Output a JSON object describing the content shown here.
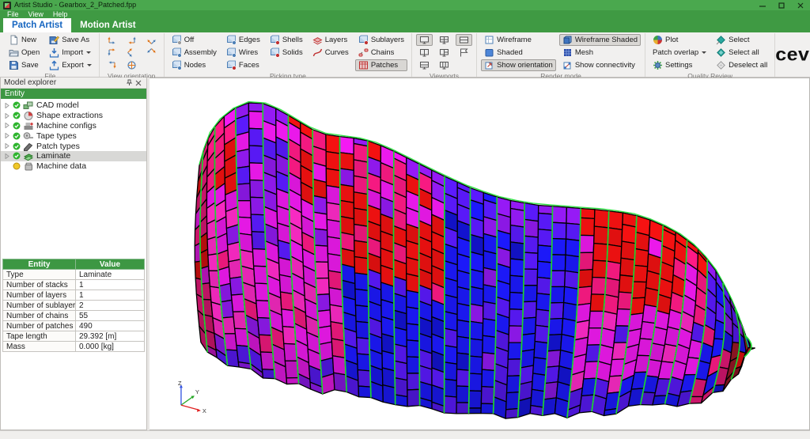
{
  "window": {
    "title": "Artist Studio - Gearbox_2_Patched.fpp"
  },
  "menu": {
    "items": [
      "File",
      "View",
      "Help"
    ]
  },
  "tabs": [
    {
      "label": "Patch Artist",
      "active": true
    },
    {
      "label": "Motion Artist",
      "active": false
    }
  ],
  "logo": "cevotec",
  "ribbon": {
    "groups": [
      {
        "label": "File",
        "columns": [
          [
            {
              "label": "New",
              "icon": "new-file"
            },
            {
              "label": "Open",
              "icon": "open-folder"
            },
            {
              "label": "Save",
              "icon": "save"
            }
          ],
          [
            {
              "label": "Save As",
              "icon": "save-as"
            },
            {
              "label": "Import",
              "icon": "import",
              "dropdown": true
            },
            {
              "label": "Export",
              "icon": "export",
              "dropdown": true
            }
          ]
        ]
      },
      {
        "label": "View orientation",
        "columns": [
          [
            {
              "icon": "view-x"
            },
            {
              "icon": "view-neg-x"
            },
            {
              "icon": "view-y"
            }
          ],
          [
            {
              "icon": "view-neg-y"
            },
            {
              "icon": "view-z"
            },
            {
              "icon": "view-neg-z"
            }
          ],
          [
            {
              "icon": "view-rotate"
            },
            {
              "icon": "view-fit"
            }
          ]
        ]
      },
      {
        "label": "Picking type",
        "columns": [
          [
            {
              "label": "Off",
              "icon": "pick-off"
            },
            {
              "label": "Assembly",
              "icon": "pick-assembly"
            },
            {
              "label": "Nodes",
              "icon": "pick-nodes"
            }
          ],
          [
            {
              "label": "Edges",
              "icon": "pick-edges"
            },
            {
              "label": "Wires",
              "icon": "pick-wires"
            },
            {
              "label": "Faces",
              "icon": "pick-faces"
            }
          ],
          [
            {
              "label": "Shells",
              "icon": "pick-shells"
            },
            {
              "label": "Solids",
              "icon": "pick-solids"
            }
          ],
          [
            {
              "label": "Layers",
              "icon": "pick-layers"
            },
            {
              "label": "Curves",
              "icon": "pick-curves"
            }
          ],
          [
            {
              "label": "Sublayers",
              "icon": "pick-sublayers"
            },
            {
              "label": "Chains",
              "icon": "pick-chains"
            },
            {
              "label": "Patches",
              "icon": "pick-patches",
              "pressed": true
            }
          ]
        ]
      },
      {
        "label": "Viewports",
        "columns": [
          [
            {
              "icon": "viewport-single",
              "pressed": true
            },
            {
              "icon": "viewport-two"
            },
            {
              "icon": "viewport-wide"
            }
          ],
          [
            {
              "icon": "viewport-quad"
            },
            {
              "icon": "viewport-three"
            },
            {
              "icon": "viewport-grid"
            }
          ],
          [
            {
              "icon": "viewport-split",
              "pressed": true
            },
            {
              "icon": "viewport-flag"
            }
          ]
        ]
      },
      {
        "label": "Render mode",
        "columns": [
          [
            {
              "label": "Wireframe",
              "icon": "wireframe"
            },
            {
              "label": "Shaded",
              "icon": "shaded"
            },
            {
              "label": "Show orientation",
              "icon": "show-orientation",
              "pressed": true
            }
          ],
          [
            {
              "label": "Wireframe Shaded",
              "icon": "wireframe-shaded",
              "pressed": true
            },
            {
              "label": "Mesh",
              "icon": "mesh"
            },
            {
              "label": "Show connectivity",
              "icon": "show-connectivity"
            }
          ]
        ]
      },
      {
        "label": "Quality Review",
        "columns": [
          [
            {
              "label": "Plot",
              "icon": "plot"
            },
            {
              "label": "Patch overlap",
              "dropdown": true
            },
            {
              "label": "Settings",
              "icon": "settings"
            }
          ],
          [
            {
              "label": "Select",
              "icon": "select"
            },
            {
              "label": "Select all",
              "icon": "select-all"
            },
            {
              "label": "Deselect all",
              "icon": "deselect-all"
            }
          ]
        ]
      }
    ]
  },
  "explorer": {
    "title": "Model explorer",
    "column_header": "Entity",
    "items": [
      {
        "label": "CAD model",
        "icon": "cad-model",
        "status": "checked",
        "expandable": true
      },
      {
        "label": "Shape extractions",
        "icon": "shape-extractions",
        "status": "checked",
        "expandable": true
      },
      {
        "label": "Machine configs",
        "icon": "machine-configs",
        "status": "checked",
        "expandable": true
      },
      {
        "label": "Tape types",
        "icon": "tape-types",
        "status": "checked",
        "expandable": true
      },
      {
        "label": "Patch types",
        "icon": "patch-types",
        "status": "checked",
        "expandable": true
      },
      {
        "label": "Laminate",
        "icon": "laminate",
        "status": "checked",
        "expandable": true,
        "selected": true
      },
      {
        "label": "Machine data",
        "icon": "machine-data",
        "status": "pending",
        "expandable": false
      }
    ]
  },
  "properties": {
    "headers": [
      "Entity",
      "Value"
    ],
    "rows": [
      [
        "Type",
        "Laminate"
      ],
      [
        "Number of stacks",
        "1"
      ],
      [
        "Number of layers",
        "1"
      ],
      [
        "Number of sublayers",
        "2"
      ],
      [
        "Number of chains",
        "55"
      ],
      [
        "Number of patches",
        "490"
      ],
      [
        "Tape length",
        "29.392 [m]"
      ],
      [
        "Mass",
        "0.000 [kg]"
      ]
    ]
  },
  "viewport": {
    "axis_labels": {
      "x": "X",
      "y": "Y",
      "z": "Z"
    },
    "axis_colors": {
      "x": "#e02020",
      "y": "#28a828",
      "z": "#3050e0"
    },
    "model_palette": {
      "red": "#e01010",
      "dark_red": "#a01828",
      "crimson": "#e8187a",
      "magenta": "#dd18dd",
      "pink": "#ee28bb",
      "purple": "#8818e0",
      "violet": "#5418ea",
      "blue": "#1b18ef",
      "deep_blue": "#1212c4",
      "guide_green": "#1ee034",
      "seam": "#000000"
    }
  },
  "colors": {
    "titlebar": "#4aa84e",
    "menubar": "#3f9a43",
    "tab_active_text": "#1565c0",
    "header_green": "#3d9743"
  }
}
